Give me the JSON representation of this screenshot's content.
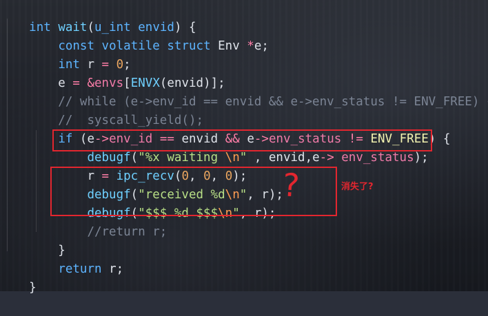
{
  "code": {
    "l1": {
      "t1": "int",
      "t2": " ",
      "t3": "wait",
      "t4": "(",
      "t5": "u_int",
      "t6": " ",
      "t7": "envid",
      "t8": ") {"
    },
    "l2": {
      "t1": "    ",
      "t2": "const",
      "t3": " ",
      "t4": "volatile",
      "t5": " ",
      "t6": "struct",
      "t7": " Env ",
      "t8": "*",
      "t9": "e",
      "t10": ";"
    },
    "l3": {
      "t1": "    ",
      "t2": "int",
      "t3": " r ",
      "t4": "=",
      "t5": " ",
      "t6": "0",
      "t7": ";"
    },
    "l4": {
      "t1": "    e ",
      "t2": "=",
      "t3": " ",
      "t4": "&",
      "t5": "envs",
      "t6": "[",
      "t7": "ENVX",
      "t8": "(envid)];"
    },
    "l5": {
      "t1": "    // while (e->env_id == envid && e->env_status != ENV_FREE) {"
    },
    "l6": {
      "t1": "    //  syscall_yield();"
    },
    "l7": {
      "t1": "    ",
      "t2": "if",
      "t3": " (",
      "t4": "e",
      "t5": "->",
      "t6": "env_id",
      "t7": " ",
      "t8": "==",
      "t9": " envid ",
      "t10": "&&",
      "t11": " ",
      "t12": "e",
      "t13": "->",
      "t14": "env_status",
      "t15": " ",
      "t16": "!=",
      "t17": " ",
      "t18": "ENV_FREE",
      "t19": ") {"
    },
    "l8": {
      "t1": "        ",
      "t2": "debugf",
      "t3": "(",
      "t4": "\"%x waiting ",
      "t5": "\\n",
      "t6": "\"",
      "t7": " , envid,",
      "t8": "e",
      "t9": "->",
      "t10": " env_status",
      "t11": ");"
    },
    "l9": {
      "t1": "        r ",
      "t2": "=",
      "t3": " ",
      "t4": "ipc_recv",
      "t5": "(",
      "t6": "0",
      "t7": ", ",
      "t8": "0",
      "t9": ", ",
      "t10": "0",
      "t11": ");"
    },
    "l10": {
      "t1": "        ",
      "t2": "debugf",
      "t3": "(",
      "t4": "\"received %d",
      "t5": "\\n",
      "t6": "\"",
      "t7": ", r);"
    },
    "l11": {
      "t1": "        ",
      "t2": "debugf",
      "t3": "(",
      "t4": "\"$$$ %d $$$",
      "t5": "\\n",
      "t6": "\"",
      "t7": ", r);"
    },
    "l12": {
      "t1": "        //return r;"
    },
    "l13": {
      "t1": "    }"
    },
    "l14": {
      "t1": "    ",
      "t2": "return",
      "t3": " r;"
    },
    "l15": {
      "t1": "}"
    }
  },
  "annotation": {
    "question_mark": "?",
    "note": "消失了?",
    "color": "#e3262f"
  },
  "colors": {
    "keyword": "#5db4ff",
    "function": "#6fd0ff",
    "string": "#b8df86",
    "escape": "#ff9d52",
    "number": "#e9a55f",
    "operator": "#ff7ea8",
    "comment": "#7b8494"
  }
}
